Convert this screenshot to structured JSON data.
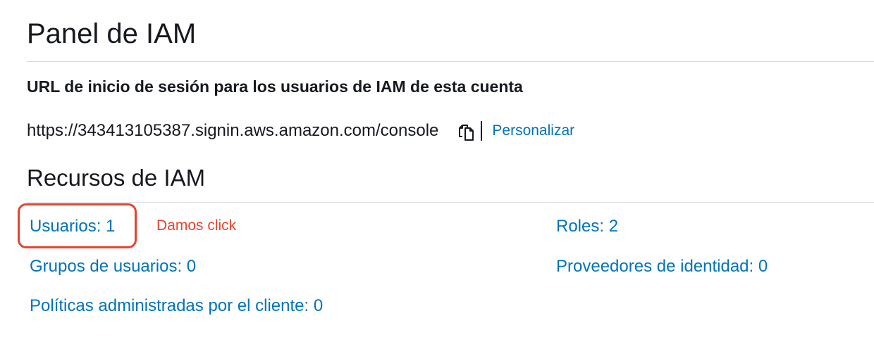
{
  "page": {
    "title": "Panel de IAM"
  },
  "signin": {
    "heading": "URL de inicio de sesión para los usuarios de IAM de esta cuenta",
    "url": "https://343413105387.signin.aws.amazon.com/console",
    "copy_icon": "copy-icon",
    "customize_label": "Personalizar"
  },
  "resources": {
    "heading": "Recursos de IAM",
    "users": "Usuarios: 1",
    "user_groups": "Grupos de usuarios: 0",
    "customer_policies": "Políticas administradas por el cliente: 0",
    "roles": "Roles: 2",
    "identity_providers": "Proveedores de identidad: 0"
  },
  "annotation": {
    "text": "Damos click",
    "color": "#e8432e"
  },
  "colors": {
    "link": "#0073bb",
    "text": "#16191f",
    "divider": "#d5dbdb",
    "highlight": "#e8432e"
  }
}
